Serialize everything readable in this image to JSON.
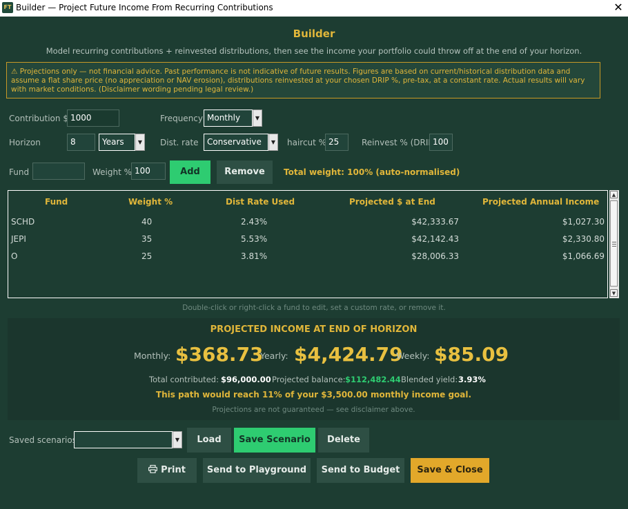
{
  "window": {
    "icon_text": "FT",
    "title": "Builder — Project Future Income From Recurring Contributions"
  },
  "header": {
    "title": "Builder",
    "subtitle": "Model recurring contributions + reinvested distributions, then see the income your portfolio could throw off at the end of your horizon."
  },
  "disclaimer": {
    "icon": "warning-icon",
    "text": "⚠ Projections only — not financial advice. Past performance is not indicative of future results. Figures are based on current/historical distribution data and assume a flat share price (no appreciation or NAV erosion), distributions reinvested at your chosen DRIP %, pre-tax, at a constant rate. Actual results will vary with market conditions.  (Disclaimer wording pending legal review.)"
  },
  "form": {
    "contribution_label": "Contribution $",
    "contribution_value": "1000",
    "frequency_label": "Frequency",
    "frequency_value": "Monthly",
    "horizon_label": "Horizon",
    "horizon_value": "8",
    "horizon_unit": "Years",
    "dist_rate_label": "Dist. rate",
    "dist_rate_value": "Conservative",
    "haircut_label": "haircut %",
    "haircut_value": "25",
    "reinvest_label": "Reinvest % (DRIP)",
    "reinvest_value": "100",
    "fund_label": "Fund",
    "fund_value": "",
    "weight_label": "Weight %",
    "weight_value": "100",
    "add_label": "Add",
    "remove_label": "Remove",
    "total_weight": "Total weight: 100%  (auto-normalised)"
  },
  "table": {
    "columns": [
      "Fund",
      "Weight %",
      "Dist Rate Used",
      "Projected $ at End",
      "Projected Annual Income"
    ],
    "rows": [
      [
        "SCHD",
        "40",
        "2.43%",
        "$42,333.67",
        "$1,027.30"
      ],
      [
        "JEPI",
        "35",
        "5.53%",
        "$42,142.43",
        "$2,330.80"
      ],
      [
        "O",
        "25",
        "3.81%",
        "$28,006.33",
        "$1,066.69"
      ]
    ]
  },
  "hint": "Double-click or right-click a fund to edit, set a custom rate, or remove it.",
  "summary": {
    "title": "PROJECTED INCOME AT END OF HORIZON",
    "monthly_label": "Monthly:",
    "monthly_value": "$368.73",
    "yearly_label": "Yearly:",
    "yearly_value": "$4,424.79",
    "weekly_label": "Weekly:",
    "weekly_value": "$85.09",
    "contributed_label": "Total contributed:",
    "contributed_value": "$96,000.00",
    "balance_label": "Projected balance:",
    "balance_value": "$112,482.44",
    "yield_label": "Blended yield:",
    "yield_value": "3.93%",
    "goal_text": "This path would reach 11% of your $3,500.00 monthly income goal.",
    "footnote": "Projections are not guaranteed — see disclaimer above."
  },
  "scenarios": {
    "label": "Saved scenarios:",
    "value": "",
    "load_label": "Load",
    "save_label": "Save Scenario",
    "delete_label": "Delete"
  },
  "actions": {
    "print_label": "Print",
    "playground_label": "Send to Playground",
    "budget_label": "Send to Budget",
    "save_close_label": "Save & Close"
  },
  "colors": {
    "background": "#1d3d32",
    "accent_gold": "#e0b63a",
    "green_button": "#2ecc71",
    "gold_button": "#e2a82a",
    "balance_green": "#2ecc71"
  }
}
